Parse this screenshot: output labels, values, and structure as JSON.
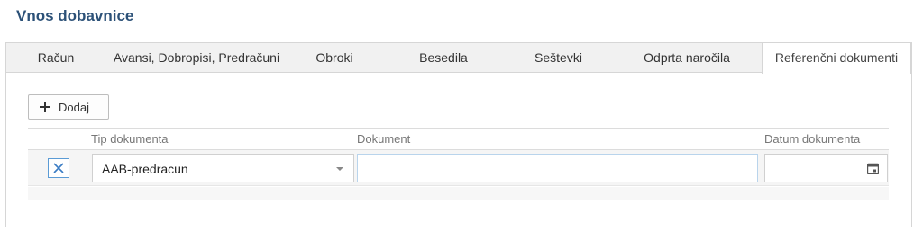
{
  "page": {
    "title": "Vnos dobavnice"
  },
  "tabs": [
    {
      "label": "Račun",
      "active": false
    },
    {
      "label": "Avansi, Dobropisi, Predračuni",
      "active": false
    },
    {
      "label": "Obroki",
      "active": false
    },
    {
      "label": "Besedila",
      "active": false
    },
    {
      "label": "Seštevki",
      "active": false
    },
    {
      "label": "Odprta naročila",
      "active": false
    },
    {
      "label": "Referenčni dokumenti",
      "active": true
    }
  ],
  "toolbar": {
    "add_label": "Dodaj",
    "add_icon": "plus-icon"
  },
  "grid": {
    "columns": [
      "Tip dokumenta",
      "Dokument",
      "Datum dokumenta"
    ],
    "rows": [
      {
        "delete_icon": "close-icon",
        "document_type": "AAB-predracun",
        "document": "",
        "document_date": ""
      }
    ]
  },
  "colors": {
    "title": "#2c5178",
    "accent": "#5b9bd5",
    "tab_bar": "#f1f1f1"
  }
}
